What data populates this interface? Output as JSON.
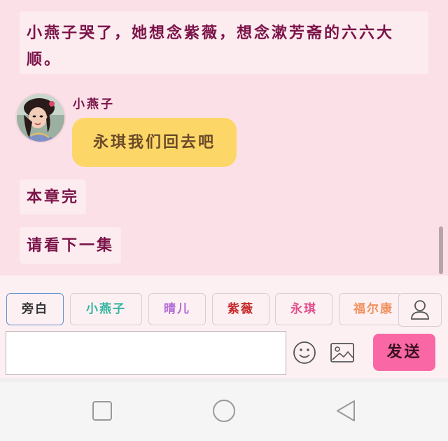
{
  "chat": {
    "narration_1": "小燕子哭了，她想念紫薇，想念漱芳斋的六六大顺。",
    "speaker": "小燕子",
    "message": "永琪我们回去吧",
    "narration_2": "本章完",
    "narration_3": "请看下一集"
  },
  "roles": [
    {
      "label": "旁白",
      "color": "#333333"
    },
    {
      "label": "小燕子",
      "color": "#2fb6a0"
    },
    {
      "label": "晴儿",
      "color": "#b26ad6"
    },
    {
      "label": "紫薇",
      "color": "#c62828"
    },
    {
      "label": "永琪",
      "color": "#e0508c"
    },
    {
      "label": "福尔康",
      "color": "#f1915e"
    }
  ],
  "composer": {
    "input_value": "",
    "send_label": "发送"
  },
  "icons": {
    "person": "person-icon",
    "emoji": "emoji-icon",
    "image": "image-icon",
    "recents": "square-nav-icon",
    "home": "circle-nav-icon",
    "back": "triangle-back-icon"
  },
  "colors": {
    "background": "#fbe0e8",
    "narration_text": "#7a1348",
    "bubble": "#fcd768",
    "send_button": "#f967a4",
    "selected_border": "#6a8fd0"
  }
}
